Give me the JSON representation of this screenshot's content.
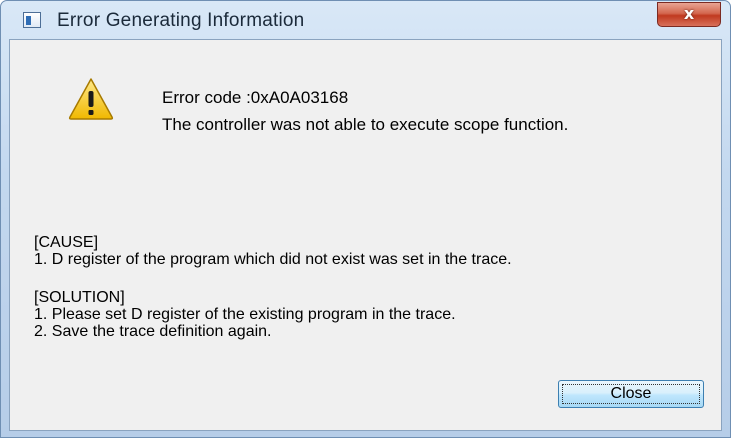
{
  "window": {
    "title": "Error Generating Information",
    "close_glyph": "x"
  },
  "message": {
    "icon": "warning-icon",
    "error_code": "Error code :0xA0A03168",
    "description": "The controller was not able to execute scope function."
  },
  "cause": {
    "heading": "[CAUSE]",
    "lines": [
      "1. D register of the program which did not exist was set in the trace."
    ]
  },
  "solution": {
    "heading": "[SOLUTION]",
    "lines": [
      "1. Please set D register of the existing program in the trace.",
      "2. Save the trace definition again."
    ]
  },
  "buttons": {
    "close_label": "Close"
  },
  "colors": {
    "titlebar": "#c3d8ef",
    "close_button": "#c0391f",
    "client_bg": "#f0f0f0",
    "warning_fill": "#f5c400"
  }
}
